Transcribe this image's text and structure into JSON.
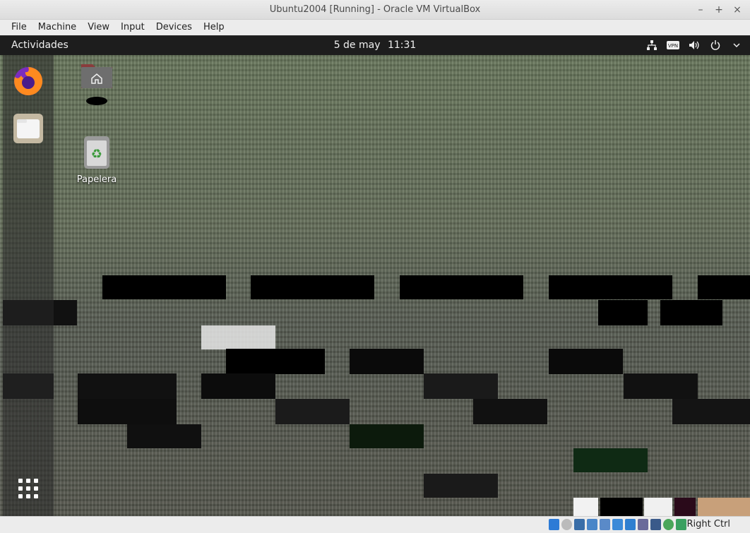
{
  "window": {
    "title": "Ubuntu2004 [Running] - Oracle VM VirtualBox",
    "controls": {
      "minimize": "–",
      "maximize": "+",
      "close": "×"
    }
  },
  "menubar": {
    "items": [
      {
        "label": "File"
      },
      {
        "label": "Machine"
      },
      {
        "label": "View"
      },
      {
        "label": "Input"
      },
      {
        "label": "Devices"
      },
      {
        "label": "Help"
      }
    ]
  },
  "guest": {
    "topbar": {
      "activities": "Actividades",
      "date": "5 de may",
      "time": "11:31",
      "tray": [
        "network-icon",
        "vpn-icon",
        "volume-icon",
        "power-icon",
        "dropdown-icon"
      ]
    },
    "dock": {
      "items": [
        "firefox-icon",
        "files-icon"
      ],
      "show_apps": "show-apps-icon"
    },
    "desktop": {
      "home_label": "",
      "trash_label": "Papelera"
    }
  },
  "statusbar": {
    "host_key": "Right Ctrl",
    "icons": [
      "hard-disk-icon",
      "optical-drive-icon",
      "audio-icon",
      "network-icon",
      "usb-icon",
      "shared-folder-icon",
      "display-icon",
      "recording-icon",
      "cpu-icon",
      "mouse-integration-icon",
      "keyboard-icon"
    ]
  }
}
